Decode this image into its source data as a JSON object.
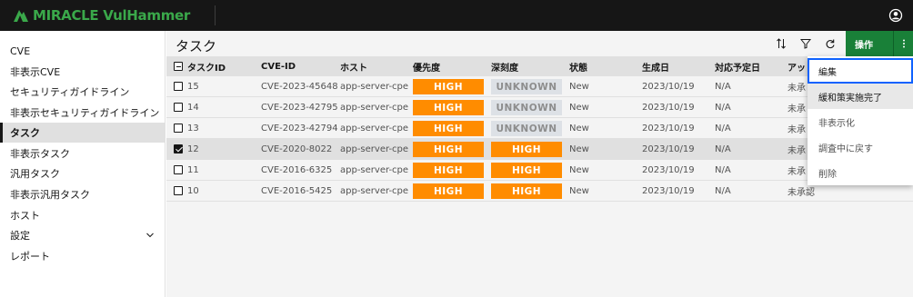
{
  "app": {
    "logo_text": "MIRACLE VulHammer",
    "user_icon": "user-avatar-icon"
  },
  "sidebar": {
    "items": [
      {
        "label": "CVE"
      },
      {
        "label": "非表示CVE"
      },
      {
        "label": "セキュリティガイドライン"
      },
      {
        "label": "非表示セキュリティガイドライン"
      },
      {
        "label": "タスク",
        "active": true
      },
      {
        "label": "非表示タスク"
      },
      {
        "label": "汎用タスク"
      },
      {
        "label": "非表示汎用タスク"
      },
      {
        "label": "ホスト"
      },
      {
        "label": "設定",
        "expandable": true
      },
      {
        "label": "レポート"
      }
    ]
  },
  "main": {
    "title": "タスク",
    "toolbar": {
      "sort_icon": "sort-icon",
      "filter_icon": "filter-icon",
      "refresh_icon": "refresh-icon",
      "action_label": "操作",
      "more_icon": "overflow-menu-icon"
    },
    "table": {
      "headers": [
        "タスクID",
        "CVE-ID",
        "ホスト",
        "優先度",
        "深刻度",
        "状態",
        "生成日",
        "対応予定日",
        "アッ"
      ],
      "rows": [
        {
          "checked": false,
          "id": "15",
          "cve": "CVE-2023-45648",
          "host": "app-server-cpe",
          "priority": "HIGH",
          "severity": "UNKNOWN",
          "status": "New",
          "created": "2023/10/19",
          "due": "N/A",
          "approval": "未承"
        },
        {
          "checked": false,
          "id": "14",
          "cve": "CVE-2023-42795",
          "host": "app-server-cpe",
          "priority": "HIGH",
          "severity": "UNKNOWN",
          "status": "New",
          "created": "2023/10/19",
          "due": "N/A",
          "approval": "未承"
        },
        {
          "checked": false,
          "id": "13",
          "cve": "CVE-2023-42794",
          "host": "app-server-cpe",
          "priority": "HIGH",
          "severity": "UNKNOWN",
          "status": "New",
          "created": "2023/10/19",
          "due": "N/A",
          "approval": "未承"
        },
        {
          "checked": true,
          "id": "12",
          "cve": "CVE-2020-8022",
          "host": "app-server-cpe",
          "priority": "HIGH",
          "severity": "HIGH",
          "status": "New",
          "created": "2023/10/19",
          "due": "N/A",
          "approval": "未承"
        },
        {
          "checked": false,
          "id": "11",
          "cve": "CVE-2016-6325",
          "host": "app-server-cpe",
          "priority": "HIGH",
          "severity": "HIGH",
          "status": "New",
          "created": "2023/10/19",
          "due": "N/A",
          "approval": "未承"
        },
        {
          "checked": false,
          "id": "10",
          "cve": "CVE-2016-5425",
          "host": "app-server-cpe",
          "priority": "HIGH",
          "severity": "HIGH",
          "status": "New",
          "created": "2023/10/19",
          "due": "N/A",
          "approval": "未承認"
        }
      ]
    }
  },
  "action_menu": {
    "items": [
      {
        "label": "編集",
        "state": "focused"
      },
      {
        "label": "緩和策実施完了",
        "state": "hovered"
      },
      {
        "label": "非表示化",
        "state": ""
      },
      {
        "label": "調査中に戻す",
        "state": ""
      },
      {
        "label": "削除",
        "state": ""
      }
    ]
  },
  "colors": {
    "topbar": "#161616",
    "brand_green": "#3aa84a",
    "action_green": "#198038",
    "high_badge": "#ff8c00",
    "unknown_badge": "#dde1e6",
    "focus_blue": "#0f62fe"
  }
}
